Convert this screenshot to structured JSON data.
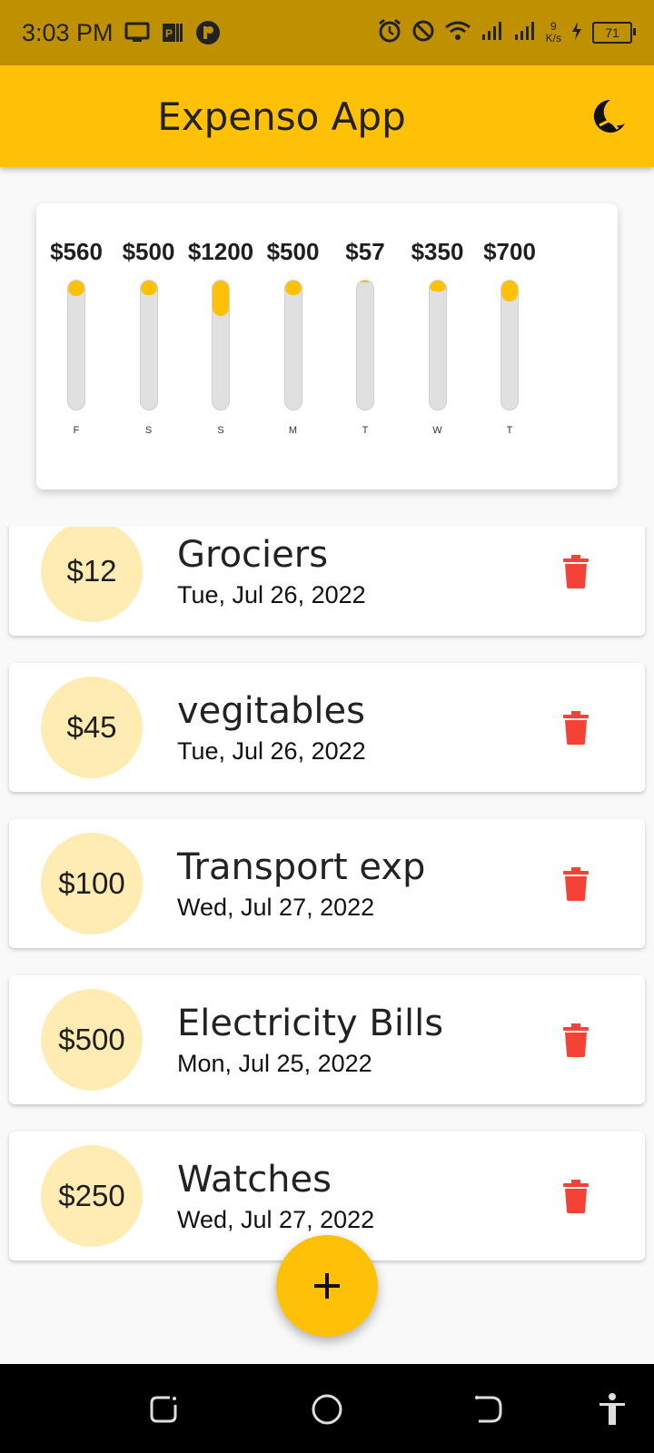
{
  "status_bar": {
    "time": "3:03 PM",
    "net_speed_value": "9",
    "net_speed_unit": "K/s",
    "battery": "71",
    "icons": [
      "monitor-icon",
      "document-icon",
      "p-badge-icon",
      "alarm-icon",
      "do-not-disturb-icon",
      "wifi-icon",
      "signal-icon",
      "signal-icon",
      "charging-icon"
    ]
  },
  "app_bar": {
    "title": "Expenso App",
    "theme_icon": "dark-mode-icon"
  },
  "chart_data": {
    "type": "bar",
    "categories": [
      "F",
      "S",
      "S",
      "M",
      "T",
      "W",
      "T"
    ],
    "labels": [
      "$560",
      "$500",
      "$1200",
      "$500",
      "$57",
      "$350",
      "$700"
    ],
    "values": [
      0.12,
      0.11,
      0.27,
      0.11,
      0.015,
      0.08,
      0.16
    ],
    "ylim": [
      0,
      1
    ]
  },
  "transactions": [
    {
      "amount": "$12",
      "title": "Grociers",
      "date": "Tue, Jul 26, 2022"
    },
    {
      "amount": "$45",
      "title": "vegitables",
      "date": "Tue, Jul 26, 2022"
    },
    {
      "amount": "$100",
      "title": "Transport exp",
      "date": "Wed, Jul 27, 2022"
    },
    {
      "amount": "$500",
      "title": "Electricity Bills",
      "date": "Mon, Jul 25, 2022"
    },
    {
      "amount": "$250",
      "title": "Watches",
      "date": "Wed, Jul 27, 2022"
    }
  ],
  "fab": {
    "icon": "plus-icon"
  },
  "colors": {
    "primary": "#ffc107",
    "status_bar": "#bf9000",
    "amount_circle": "#ffecb3",
    "delete": "#f44336",
    "bar_track": "#e0e0e0"
  }
}
